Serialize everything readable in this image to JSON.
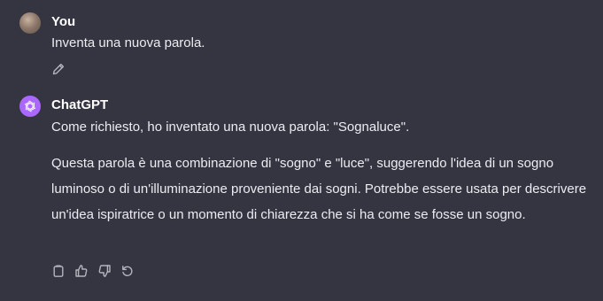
{
  "conversation": {
    "user": {
      "author": "You",
      "message": "Inventa una nuova parola."
    },
    "assistant": {
      "author": "ChatGPT",
      "paragraphs": [
        "Come richiesto, ho inventato una nuova parola: \"Sognaluce\".",
        "Questa parola è una combinazione di \"sogno\" e \"luce\", suggerendo l'idea di un sogno luminoso o di un'illuminazione proveniente dai sogni. Potrebbe essere usata per descrivere un'idea ispiratrice o un momento di chiarezza che si ha come se fosse un sogno."
      ]
    }
  },
  "icons": {
    "edit": "pencil-icon",
    "copy": "copy-icon",
    "like": "thumbs-up-icon",
    "dislike": "thumbs-down-icon",
    "regenerate": "regenerate-icon",
    "assistant_logo": "openai-logo-icon"
  },
  "colors": {
    "background": "#343541",
    "text": "#ececf1",
    "author": "#ffffff",
    "icon": "#b4b4bd",
    "assistant_avatar": "#ab68ff"
  }
}
